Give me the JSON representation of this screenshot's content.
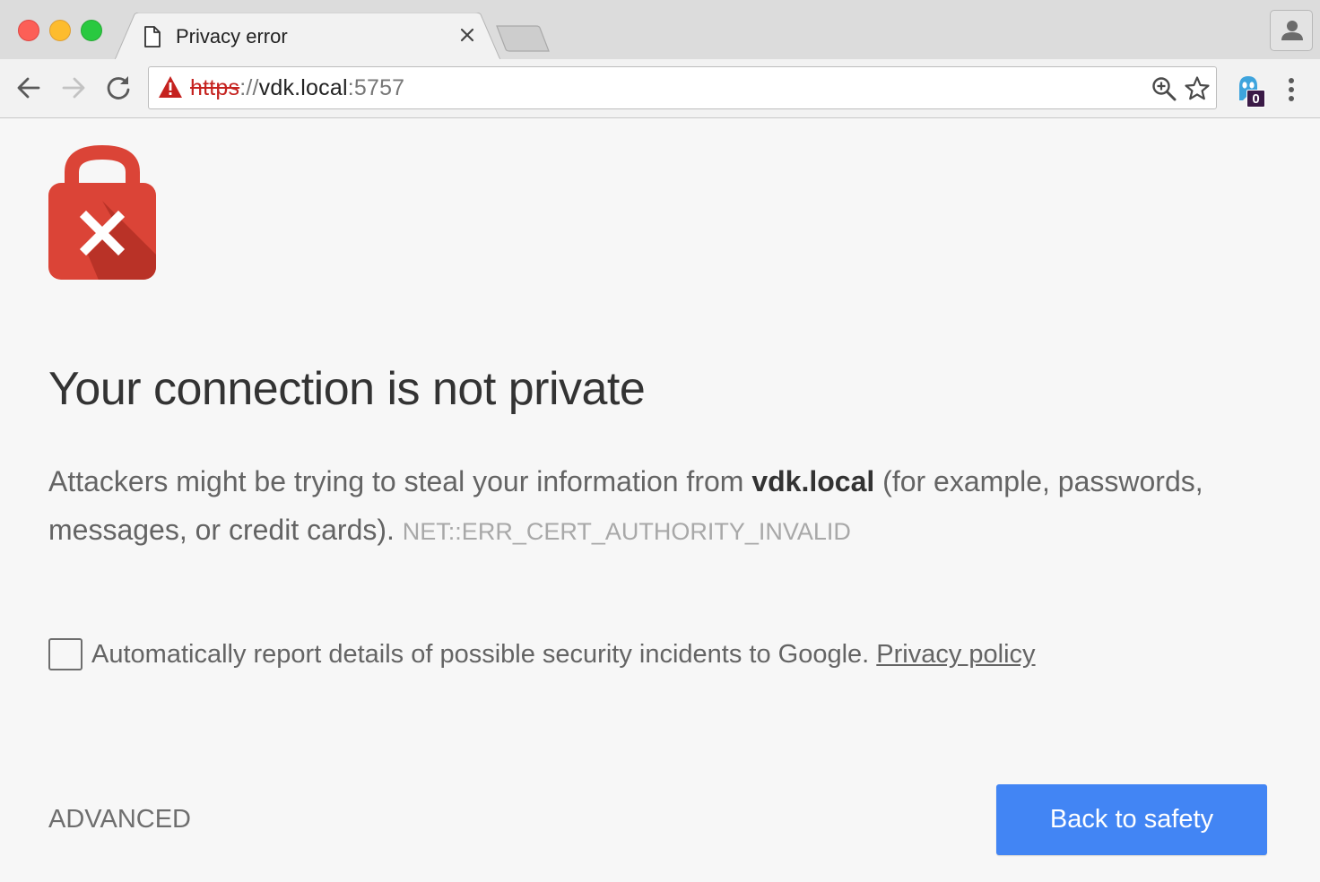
{
  "window": {
    "traffic_lights": [
      "close",
      "minimize",
      "maximize"
    ]
  },
  "tab": {
    "title": "Privacy error",
    "favicon": "document-icon",
    "close_icon": "close-icon"
  },
  "toolbar": {
    "url_scheme": "https",
    "url_separator": "://",
    "url_host": "vdk.local",
    "url_port": ":5757",
    "security_state": "not-secure",
    "extension_badge": "0"
  },
  "page": {
    "heading": "Your connection is not private",
    "explanation_before": "Attackers might be trying to steal your information from ",
    "explanation_host": "vdk.local",
    "explanation_after": " (for example, passwords, messages, or credit cards). ",
    "error_code": "NET::ERR_CERT_AUTHORITY_INVALID",
    "report_text": "Automatically report details of possible security incidents to Google. ",
    "privacy_link": "Privacy policy",
    "report_checked": false,
    "advanced_label": "ADVANCED",
    "safety_label": "Back to safety"
  },
  "colors": {
    "accent": "#4285f4",
    "danger": "#db4437",
    "danger_dark": "#c5221f"
  }
}
